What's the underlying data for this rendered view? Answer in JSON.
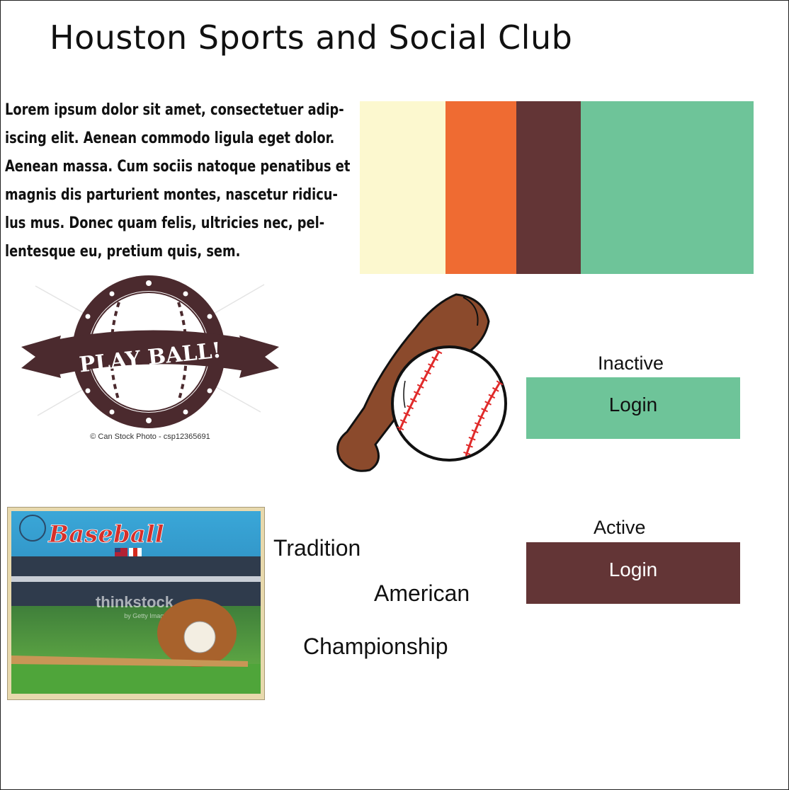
{
  "header": {
    "title": "Houston Sports and Social Club"
  },
  "intro": {
    "lines": [
      "Lorem ipsum dolor sit amet, consectetuer adip-",
      "iscing elit. Aenean commodo ligula eget dolor.",
      "Aenean massa. Cum sociis natoque penatibus et",
      "magnis dis parturient montes, nascetur ridicu-",
      "lus mus. Donec quam felis, ultricies nec, pel-",
      "lentesque eu, pretium quis, sem."
    ]
  },
  "palette": {
    "colors": [
      "#fcf8cf",
      "#ef6b32",
      "#633536",
      "#6ec499"
    ]
  },
  "images": {
    "play_ball": {
      "banner_text": "PLAY BALL!",
      "credit": "© Can Stock Photo - csp12365691"
    },
    "postcard": {
      "headline": "Baseball",
      "watermark": "thinkstock",
      "watermark_sub": "by Getty Images"
    }
  },
  "buttons": {
    "inactive": {
      "state_label": "Inactive",
      "label": "Login",
      "bg": "#6ec499",
      "fg": "#111111"
    },
    "active": {
      "state_label": "Active",
      "label": "Login",
      "bg": "#633536",
      "fg": "#ffffff"
    }
  },
  "words": {
    "tradition": "Tradition",
    "american": "American",
    "championship": "Championship"
  }
}
